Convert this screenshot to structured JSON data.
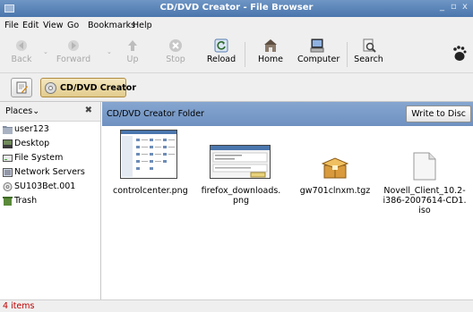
{
  "window": {
    "title": "CD/DVD Creator - File Browser",
    "minimize_glyph": "_",
    "maximize_glyph": "▫",
    "close_glyph": "x"
  },
  "menu": [
    "File",
    "Edit",
    "View",
    "Go",
    "Bookmarks",
    "Help"
  ],
  "toolbar": {
    "back": "Back",
    "forward": "Forward",
    "up": "Up",
    "stop": "Stop",
    "reload": "Reload",
    "home": "Home",
    "computer": "Computer",
    "search": "Search"
  },
  "location": {
    "path_button": "CD/DVD Creator"
  },
  "sidebar": {
    "header": "Places",
    "header_arrow": "⌄",
    "close": "✖",
    "items": [
      {
        "label": "user123",
        "icon": "folder-icon"
      },
      {
        "label": "Desktop",
        "icon": "desktop-icon"
      },
      {
        "label": "File System",
        "icon": "drive-icon"
      },
      {
        "label": "Network Servers",
        "icon": "network-icon"
      },
      {
        "label": "SU103Bet.001",
        "icon": "cd-icon"
      },
      {
        "label": "Trash",
        "icon": "trash-icon"
      }
    ]
  },
  "main": {
    "folder_title": "CD/DVD Creator Folder",
    "write_button": "Write to Disc",
    "files": [
      {
        "name_lines": [
          "controlcenter.png"
        ],
        "icon": "image-thumbnail"
      },
      {
        "name_lines": [
          "firefox_downloads.",
          "png"
        ],
        "icon": "image-thumbnail"
      },
      {
        "name_lines": [
          "gw701clnxm.tgz"
        ],
        "icon": "archive-icon"
      },
      {
        "name_lines": [
          "Novell_Client_10.2-",
          "i386-2007614-CD1.",
          "iso"
        ],
        "icon": "disc-image-icon"
      }
    ]
  },
  "status": {
    "text": "4 items"
  }
}
